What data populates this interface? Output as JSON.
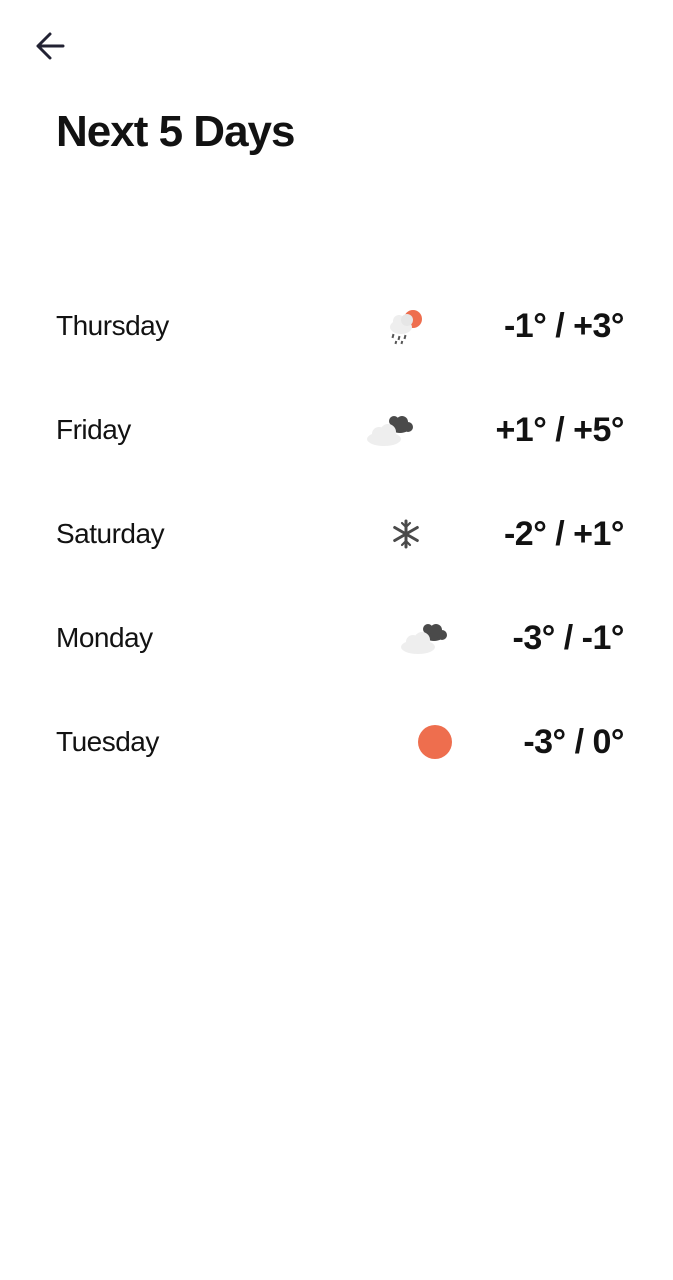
{
  "header": {
    "back_icon": "arrow-left-icon",
    "title": "Next 5 Days"
  },
  "colors": {
    "text": "#121212",
    "sun": "#EE6E4E",
    "cloud_light": "#EEEEEE",
    "cloud_dark": "#4A4A4A"
  },
  "forecast": [
    {
      "day": "Thursday",
      "icon": "sun-cloud-rain-icon",
      "temp": "-1° / +3°"
    },
    {
      "day": "Friday",
      "icon": "cloudy-icon",
      "temp": "+1° / +5°"
    },
    {
      "day": "Saturday",
      "icon": "snowflake-icon",
      "temp": "-2° / +1°"
    },
    {
      "day": "Monday",
      "icon": "cloudy-icon",
      "temp": "-3° / -1°"
    },
    {
      "day": "Tuesday",
      "icon": "sun-icon",
      "temp": "-3° / 0°"
    }
  ]
}
